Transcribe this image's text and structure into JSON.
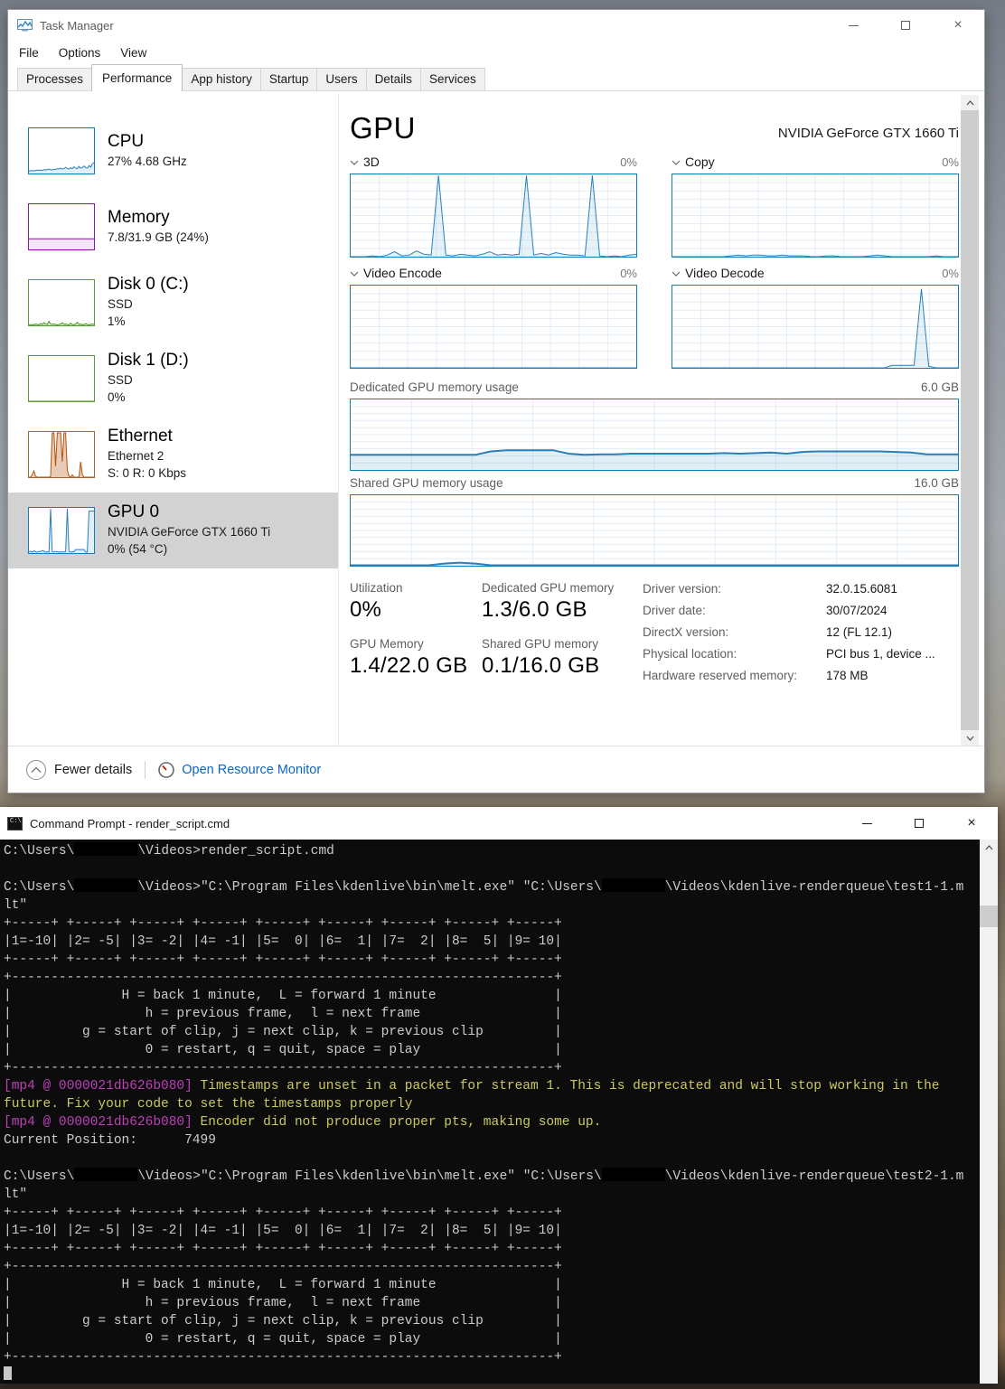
{
  "task_manager": {
    "title": "Task Manager",
    "window_controls": [
      "minimize",
      "maximize",
      "close"
    ],
    "menu": [
      "File",
      "Options",
      "View"
    ],
    "tabs": [
      {
        "label": "Processes",
        "active": false
      },
      {
        "label": "Performance",
        "active": true
      },
      {
        "label": "App history",
        "active": false
      },
      {
        "label": "Startup",
        "active": false
      },
      {
        "label": "Users",
        "active": false
      },
      {
        "label": "Details",
        "active": false
      },
      {
        "label": "Services",
        "active": false
      }
    ],
    "sidebar": [
      {
        "title": "CPU",
        "lines": [
          "27% 4.68 GHz"
        ]
      },
      {
        "title": "Memory",
        "lines": [
          "7.8/31.9 GB (24%)"
        ]
      },
      {
        "title": "Disk 0 (C:)",
        "lines": [
          "SSD",
          "1%"
        ]
      },
      {
        "title": "Disk 1 (D:)",
        "lines": [
          "SSD",
          "0%"
        ]
      },
      {
        "title": "Ethernet",
        "lines": [
          "Ethernet 2",
          "S: 0 R: 0 Kbps"
        ]
      },
      {
        "title": "GPU 0",
        "lines": [
          "NVIDIA GeForce GTX 1660 Ti",
          "0%  (54 °C)"
        ]
      }
    ],
    "gpu_panel": {
      "title": "GPU",
      "device_name": "NVIDIA GeForce GTX 1660 Ti",
      "charts": [
        {
          "name": "3D",
          "value_label": "0%"
        },
        {
          "name": "Copy",
          "value_label": "0%"
        },
        {
          "name": "Video Encode",
          "value_label": "0%"
        },
        {
          "name": "Video Decode",
          "value_label": "0%"
        }
      ],
      "memory_charts": [
        {
          "name": "Dedicated GPU memory usage",
          "max_label": "6.0 GB"
        },
        {
          "name": "Shared GPU memory usage",
          "max_label": "16.0 GB"
        }
      ],
      "stats": {
        "utilization_label": "Utilization",
        "utilization": "0%",
        "gpu_memory_label": "GPU Memory",
        "gpu_memory": "1.4/22.0 GB",
        "dedicated_label": "Dedicated GPU memory",
        "dedicated": "1.3/6.0 GB",
        "shared_label": "Shared GPU memory",
        "shared": "0.1/16.0 GB",
        "details": [
          {
            "label": "Driver version:",
            "value": "32.0.15.6081"
          },
          {
            "label": "Driver date:",
            "value": "30/07/2024"
          },
          {
            "label": "DirectX version:",
            "value": "12 (FL 12.1)"
          },
          {
            "label": "Physical location:",
            "value": "PCI bus 1, device ..."
          },
          {
            "label": "Hardware reserved memory:",
            "value": "178 MB"
          }
        ]
      }
    },
    "footer": {
      "fewer_details": "Fewer details",
      "resource_monitor": "Open Resource Monitor"
    }
  },
  "chart_data": [
    {
      "id": "sidebar-cpu",
      "title": "CPU utilization %",
      "type": "area",
      "ylim": [
        0,
        100
      ],
      "grid": false,
      "border": "#117dbb",
      "color": "#2b7fb8",
      "fill": "rgba(17,125,187,0.12)",
      "lw": 1,
      "values": [
        6,
        6,
        7,
        6,
        7,
        8,
        7,
        8,
        7,
        9,
        8,
        9,
        10,
        9,
        8,
        10,
        9,
        11,
        10,
        12,
        10,
        11,
        14,
        11,
        10,
        13,
        11,
        15,
        12,
        11,
        16,
        12,
        13,
        17,
        13,
        12,
        18,
        14,
        22,
        25
      ]
    },
    {
      "id": "sidebar-memory",
      "title": "Memory usage % of 31.9 GB",
      "type": "area",
      "ylim": [
        0,
        100
      ],
      "grid": false,
      "border": "#8b12ae",
      "color": "#8b12ae",
      "fill": "rgba(139,18,174,0.10)",
      "lw": 1,
      "values": [
        24,
        24
      ]
    },
    {
      "id": "sidebar-disk0",
      "title": "Disk 0 (C:) active time %",
      "type": "area",
      "ylim": [
        0,
        100
      ],
      "grid": false,
      "border": "#5a9e33",
      "color": "#4f9e1a",
      "fill": "rgba(77,158,26,0.25)",
      "lw": 1,
      "values": [
        2,
        1,
        2,
        1,
        3,
        2,
        1,
        4,
        2,
        6,
        3,
        2,
        9,
        4,
        2,
        3,
        2,
        1,
        2,
        3,
        6,
        2,
        3,
        2,
        1,
        5,
        2,
        1,
        3,
        7,
        2,
        3,
        1,
        2,
        4,
        2,
        1,
        2,
        3,
        2
      ]
    },
    {
      "id": "sidebar-disk1",
      "title": "Disk 1 (D:) active time %",
      "type": "area",
      "ylim": [
        0,
        100
      ],
      "grid": false,
      "border": "#5a9e33",
      "color": "#4f9e1a",
      "fill": "rgba(77,158,26,0.25)",
      "lw": 1,
      "values": [
        0,
        0
      ]
    },
    {
      "id": "sidebar-ethernet",
      "title": "Ethernet throughput",
      "type": "area",
      "ylim": [
        0,
        100
      ],
      "grid": false,
      "border": "#a5672f",
      "color": "#b0540c",
      "fill": "rgba(176,84,12,0.30)",
      "lw": 1,
      "values": [
        0,
        0,
        6,
        14,
        2,
        0,
        0,
        0,
        0,
        0,
        0,
        0,
        0,
        2,
        100,
        100,
        25,
        100,
        100,
        100,
        35,
        100,
        100,
        15,
        3,
        0,
        5,
        0,
        0,
        0,
        0,
        35,
        6,
        0,
        0,
        0,
        0,
        0,
        0,
        0
      ]
    },
    {
      "id": "sidebar-gpu",
      "title": "GPU 0 utilization %",
      "type": "area",
      "ylim": [
        0,
        100
      ],
      "grid": false,
      "border": "#117dbb",
      "color": "#2b7fb8",
      "fill": "rgba(17,125,187,0.12)",
      "lw": 1,
      "values": [
        3,
        4,
        2,
        5,
        3,
        2,
        4,
        3,
        6,
        4,
        2,
        3,
        2,
        100,
        3,
        2,
        4,
        3,
        2,
        3,
        2,
        3,
        3,
        100,
        4,
        2,
        3,
        3,
        8,
        8,
        8,
        8,
        8,
        8,
        2,
        2,
        95,
        95,
        95,
        95
      ]
    },
    {
      "id": "gpu-3d",
      "title": "3D utilization %",
      "type": "area",
      "ylim": [
        0,
        100
      ],
      "grid": true,
      "grid_color": "#e3edf6",
      "border": "#117dbb",
      "color": "#2b7fb8",
      "fill": "rgba(17,125,187,0.10)",
      "lw": 1,
      "values": [
        0,
        0,
        0,
        1,
        0,
        2,
        6,
        1,
        2,
        7,
        3,
        2,
        100,
        2,
        1,
        3,
        2,
        1,
        3,
        6,
        2,
        3,
        2,
        3,
        100,
        2,
        4,
        2,
        5,
        3,
        2,
        2,
        1,
        100,
        1,
        0,
        1,
        0,
        2,
        3
      ]
    },
    {
      "id": "gpu-copy",
      "title": "Copy utilization %",
      "type": "area",
      "ylim": [
        0,
        100
      ],
      "grid": true,
      "grid_color": "#e3edf6",
      "border": "#117dbb",
      "color": "#2b7fb8",
      "fill": "rgba(17,125,187,0.10)",
      "lw": 1,
      "values": [
        0,
        0,
        0,
        0,
        0,
        0,
        0,
        0,
        1,
        2,
        1,
        2,
        2,
        1,
        1,
        2,
        1,
        1,
        1,
        0,
        0,
        1,
        1,
        0,
        0,
        0,
        0,
        1,
        2,
        1,
        0,
        0,
        0,
        0,
        0,
        0,
        1,
        0,
        0,
        0
      ]
    },
    {
      "id": "gpu-video-encode",
      "title": "Video Encode utilization %",
      "type": "area",
      "ylim": [
        0,
        100
      ],
      "grid": true,
      "grid_color": "#e3edf6",
      "border": "#117dbb",
      "color": "#2b7fb8",
      "fill": "rgba(17,125,187,0.10)",
      "lw": 1,
      "values": [
        0,
        0,
        0,
        0,
        0,
        0,
        0,
        0,
        0,
        0,
        0,
        0,
        0,
        0,
        0,
        0,
        0,
        0,
        0,
        0,
        0,
        0,
        0,
        0,
        0,
        0,
        0,
        0,
        0,
        0,
        0,
        0,
        0,
        0,
        0,
        0,
        0,
        0,
        0,
        0
      ]
    },
    {
      "id": "gpu-video-decode",
      "title": "Video Decode utilization %",
      "type": "area",
      "ylim": [
        0,
        100
      ],
      "grid": true,
      "grid_color": "#e3edf6",
      "border": "#117dbb",
      "color": "#2b7fb8",
      "fill": "rgba(17,125,187,0.10)",
      "lw": 1,
      "values": [
        0,
        0,
        0,
        0,
        0,
        0,
        0,
        0,
        0,
        0,
        0,
        0,
        0,
        0,
        0,
        0,
        0,
        0,
        0,
        0,
        0,
        0,
        0,
        0,
        0,
        0,
        0,
        0,
        0,
        0,
        3,
        3,
        3,
        3,
        97,
        2,
        0,
        0,
        0,
        0
      ]
    },
    {
      "id": "gpu-dedicated-memory",
      "title": "Dedicated GPU memory usage (GB)",
      "type": "area",
      "ylim": [
        0,
        6
      ],
      "grid": true,
      "grid_color": "#e3edf6",
      "border": "#117dbb",
      "color": "#2b7fb8",
      "fill": "rgba(17,125,187,0.13)",
      "lw": 2,
      "values": [
        1.3,
        1.3,
        1.3,
        1.3,
        1.3,
        1.3,
        1.3,
        1.3,
        1.3,
        1.6,
        1.7,
        1.7,
        1.7,
        1.7,
        1.4,
        1.3,
        1.35,
        1.35,
        1.4,
        1.4,
        1.4,
        1.4,
        1.4,
        1.4,
        1.45,
        1.4,
        1.45,
        1.5,
        1.4,
        1.55,
        1.6,
        1.6,
        1.6,
        1.6,
        1.6,
        1.55,
        1.5,
        1.35,
        1.35,
        1.35
      ]
    },
    {
      "id": "gpu-shared-memory",
      "title": "Shared GPU memory usage (GB)",
      "type": "area",
      "ylim": [
        0,
        16
      ],
      "grid": true,
      "grid_color": "#e3edf6",
      "border": "#117dbb",
      "color": "#2b7fb8",
      "fill": "rgba(17,125,187,0.13)",
      "lw": 2,
      "values": [
        0.1,
        0.1,
        0.1,
        0.1,
        0.1,
        0.1,
        0.5,
        0.7,
        0.5,
        0.1,
        0.1,
        0.1,
        0.1,
        0.1,
        0.1,
        0.1,
        0.1,
        0.1,
        0.1,
        0.1,
        0.1,
        0.1,
        0.1,
        0.1,
        0.1,
        0.1,
        0.1,
        0.1,
        0.1,
        0.1,
        0.1,
        0.1,
        0.1,
        0.1,
        0.1,
        0.1,
        0.1,
        0.1,
        0.1,
        0.1
      ]
    }
  ],
  "command_prompt": {
    "title": "Command Prompt - render_script.cmd",
    "window_controls": [
      "minimize",
      "maximize",
      "close"
    ],
    "colors": {
      "background": "#0c0c0c",
      "default": "#cccccc",
      "magenta": "#bc3fbc",
      "yellow": "#caca5e"
    },
    "lines": [
      [
        {
          "t": "C:\\Users\\"
        },
        {
          "r": 1
        },
        {
          "t": "\\Videos>render_script.cmd"
        }
      ],
      [],
      [
        {
          "t": "C:\\Users\\"
        },
        {
          "r": 1
        },
        {
          "t": "\\Videos>\"C:\\Program Files\\kdenlive\\bin\\melt.exe\" \"C:\\Users\\"
        },
        {
          "r": 1
        },
        {
          "t": "\\Videos\\kdenlive-renderqueue\\test1-1.m"
        }
      ],
      [
        {
          "t": "lt\""
        }
      ],
      [
        {
          "t": "+-----+ +-----+ +-----+ +-----+ +-----+ +-----+ +-----+ +-----+ +-----+"
        }
      ],
      [
        {
          "t": "|1=-10| |2= -5| |3= -2| |4= -1| |5=  0| |6=  1| |7=  2| |8=  5| |9= 10|"
        }
      ],
      [
        {
          "t": "+-----+ +-----+ +-----+ +-----+ +-----+ +-----+ +-----+ +-----+ +-----+"
        }
      ],
      [
        {
          "t": "+---------------------------------------------------------------------+"
        }
      ],
      [
        {
          "t": "|              H = back 1 minute,  L = forward 1 minute               |"
        }
      ],
      [
        {
          "t": "|                 h = previous frame,  l = next frame                 |"
        }
      ],
      [
        {
          "t": "|         g = start of clip, j = next clip, k = previous clip         |"
        }
      ],
      [
        {
          "t": "|                 0 = restart, q = quit, space = play                 |"
        }
      ],
      [
        {
          "t": "+---------------------------------------------------------------------+"
        }
      ],
      [
        {
          "t": "[mp4 @ 0000021db626b080]",
          "c": "m"
        },
        {
          "t": " Timestamps are unset in a packet for stream 1. This is deprecated and will stop working in the",
          "c": "y"
        }
      ],
      [
        {
          "t": "future. Fix your code to set the timestamps properly",
          "c": "y"
        }
      ],
      [
        {
          "t": "[mp4 @ 0000021db626b080]",
          "c": "m"
        },
        {
          "t": " Encoder did not produce proper pts, making some up.",
          "c": "y"
        }
      ],
      [
        {
          "t": "Current Position:      7499"
        }
      ],
      [],
      [
        {
          "t": "C:\\Users\\"
        },
        {
          "r": 1
        },
        {
          "t": "\\Videos>\"C:\\Program Files\\kdenlive\\bin\\melt.exe\" \"C:\\Users\\"
        },
        {
          "r": 1
        },
        {
          "t": "\\Videos\\kdenlive-renderqueue\\test2-1.m"
        }
      ],
      [
        {
          "t": "lt\""
        }
      ],
      [
        {
          "t": "+-----+ +-----+ +-----+ +-----+ +-----+ +-----+ +-----+ +-----+ +-----+"
        }
      ],
      [
        {
          "t": "|1=-10| |2= -5| |3= -2| |4= -1| |5=  0| |6=  1| |7=  2| |8=  5| |9= 10|"
        }
      ],
      [
        {
          "t": "+-----+ +-----+ +-----+ +-----+ +-----+ +-----+ +-----+ +-----+ +-----+"
        }
      ],
      [
        {
          "t": "+---------------------------------------------------------------------+"
        }
      ],
      [
        {
          "t": "|              H = back 1 minute,  L = forward 1 minute               |"
        }
      ],
      [
        {
          "t": "|                 h = previous frame,  l = next frame                 |"
        }
      ],
      [
        {
          "t": "|         g = start of clip, j = next clip, k = previous clip         |"
        }
      ],
      [
        {
          "t": "|                 0 = restart, q = quit, space = play                 |"
        }
      ],
      [
        {
          "t": "+---------------------------------------------------------------------+"
        }
      ],
      [
        {
          "cur": 1
        }
      ]
    ]
  }
}
